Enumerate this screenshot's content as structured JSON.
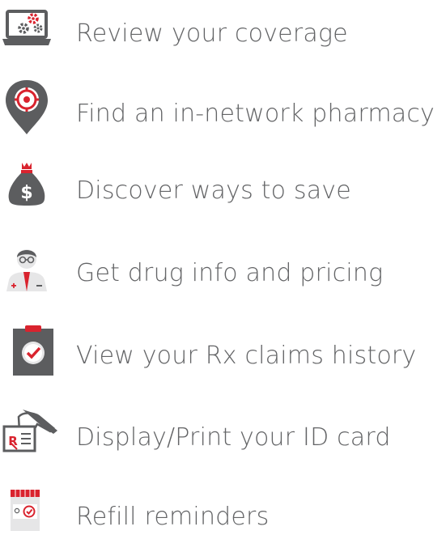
{
  "colors": {
    "text": "#636466",
    "icon_gray": "#5c5d5f",
    "icon_red": "#d9232e",
    "icon_light": "#e6e6e7"
  },
  "features": [
    {
      "label": "Review your coverage",
      "icon": "laptop-gears-icon"
    },
    {
      "label": "Find an in-network pharmacy",
      "icon": "map-pin-target-icon"
    },
    {
      "label": "Discover ways to save",
      "icon": "money-bag-icon"
    },
    {
      "label": "Get drug info and pricing",
      "icon": "pharmacist-icon"
    },
    {
      "label": "View your Rx claims history",
      "icon": "clipboard-check-icon"
    },
    {
      "label": "Display/Print your ID card",
      "icon": "id-card-hand-icon"
    },
    {
      "label": "Refill reminders",
      "icon": "pill-bottle-check-icon"
    }
  ]
}
